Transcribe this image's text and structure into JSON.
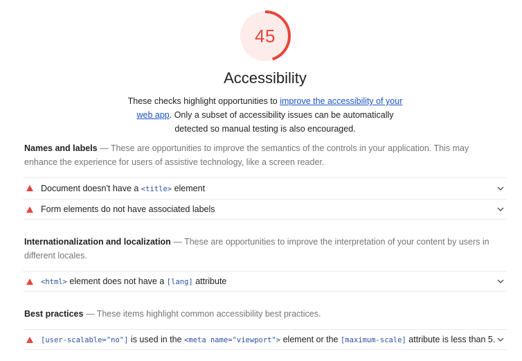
{
  "score": {
    "value": "45",
    "fraction": 0.45,
    "color": "#e8453c",
    "track_color": "#fdecea"
  },
  "category": {
    "title": "Accessibility",
    "desc_before": "These checks highlight opportunities to ",
    "desc_link": "improve the accessibility of your web app",
    "desc_after": ". Only a subset of accessibility issues can be automatically detected so manual testing is also encouraged."
  },
  "groups": [
    {
      "title": "Names and labels",
      "separator": " — ",
      "description": "These are opportunities to improve the semantics of the controls in your application. This may enhance the experience for users of assistive technology, like a screen reader.",
      "audits": [
        {
          "pre": "Document doesn't have a ",
          "code": "<title>",
          "post": " element"
        },
        {
          "text": "Form elements do not have associated labels"
        }
      ]
    },
    {
      "title": "Internationalization and localization",
      "separator": " — ",
      "description": "These are opportunities to improve the interpretation of your content by users in different locales.",
      "audits": [
        {
          "code": "<html>",
          "mid": " element does not have a ",
          "code2": "[lang]",
          "post": " attribute"
        }
      ]
    },
    {
      "title": "Best practices",
      "separator": " — ",
      "description": "These items highlight common accessibility best practices.",
      "audits": [
        {
          "code": "[user-scalable=\"no\"]",
          "mid": " is used in the ",
          "code2": "<meta name=\"viewport\">",
          "mid2": " element or the ",
          "code3": "[maximum-scale]",
          "post": " attribute is less than 5."
        }
      ]
    }
  ],
  "icons": {
    "fail": "red-triangle-icon",
    "expand": "chevron-down-icon"
  }
}
